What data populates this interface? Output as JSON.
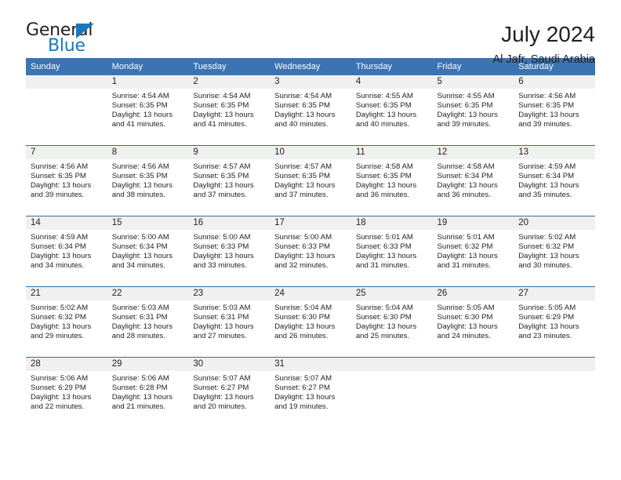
{
  "logo": {
    "primary_text": "General",
    "secondary_text": "Blue",
    "triangle_icon": "triangle-icon",
    "accent_color": "#1878be"
  },
  "header": {
    "title": "July 2024",
    "location": "Al Jafr, Saudi Arabia"
  },
  "theme": {
    "header_blue": "#3b74b4",
    "row_border_blue": "#2e6da4",
    "daynum_band": "#f0f0f0",
    "text": "#231f20"
  },
  "calendar": {
    "weekday_headers": [
      "Sunday",
      "Monday",
      "Tuesday",
      "Wednesday",
      "Thursday",
      "Friday",
      "Saturday"
    ],
    "weeks": [
      [
        {
          "day": "",
          "lines": []
        },
        {
          "day": "1",
          "lines": [
            "Sunrise: 4:54 AM",
            "Sunset: 6:35 PM",
            "Daylight: 13 hours and 41 minutes."
          ]
        },
        {
          "day": "2",
          "lines": [
            "Sunrise: 4:54 AM",
            "Sunset: 6:35 PM",
            "Daylight: 13 hours and 41 minutes."
          ]
        },
        {
          "day": "3",
          "lines": [
            "Sunrise: 4:54 AM",
            "Sunset: 6:35 PM",
            "Daylight: 13 hours and 40 minutes."
          ]
        },
        {
          "day": "4",
          "lines": [
            "Sunrise: 4:55 AM",
            "Sunset: 6:35 PM",
            "Daylight: 13 hours and 40 minutes."
          ]
        },
        {
          "day": "5",
          "lines": [
            "Sunrise: 4:55 AM",
            "Sunset: 6:35 PM",
            "Daylight: 13 hours and 39 minutes."
          ]
        },
        {
          "day": "6",
          "lines": [
            "Sunrise: 4:56 AM",
            "Sunset: 6:35 PM",
            "Daylight: 13 hours and 39 minutes."
          ]
        }
      ],
      [
        {
          "day": "7",
          "lines": [
            "Sunrise: 4:56 AM",
            "Sunset: 6:35 PM",
            "Daylight: 13 hours and 39 minutes."
          ]
        },
        {
          "day": "8",
          "lines": [
            "Sunrise: 4:56 AM",
            "Sunset: 6:35 PM",
            "Daylight: 13 hours and 38 minutes."
          ]
        },
        {
          "day": "9",
          "lines": [
            "Sunrise: 4:57 AM",
            "Sunset: 6:35 PM",
            "Daylight: 13 hours and 37 minutes."
          ]
        },
        {
          "day": "10",
          "lines": [
            "Sunrise: 4:57 AM",
            "Sunset: 6:35 PM",
            "Daylight: 13 hours and 37 minutes."
          ]
        },
        {
          "day": "11",
          "lines": [
            "Sunrise: 4:58 AM",
            "Sunset: 6:35 PM",
            "Daylight: 13 hours and 36 minutes."
          ]
        },
        {
          "day": "12",
          "lines": [
            "Sunrise: 4:58 AM",
            "Sunset: 6:34 PM",
            "Daylight: 13 hours and 36 minutes."
          ]
        },
        {
          "day": "13",
          "lines": [
            "Sunrise: 4:59 AM",
            "Sunset: 6:34 PM",
            "Daylight: 13 hours and 35 minutes."
          ]
        }
      ],
      [
        {
          "day": "14",
          "lines": [
            "Sunrise: 4:59 AM",
            "Sunset: 6:34 PM",
            "Daylight: 13 hours and 34 minutes."
          ]
        },
        {
          "day": "15",
          "lines": [
            "Sunrise: 5:00 AM",
            "Sunset: 6:34 PM",
            "Daylight: 13 hours and 34 minutes."
          ]
        },
        {
          "day": "16",
          "lines": [
            "Sunrise: 5:00 AM",
            "Sunset: 6:33 PM",
            "Daylight: 13 hours and 33 minutes."
          ]
        },
        {
          "day": "17",
          "lines": [
            "Sunrise: 5:00 AM",
            "Sunset: 6:33 PM",
            "Daylight: 13 hours and 32 minutes."
          ]
        },
        {
          "day": "18",
          "lines": [
            "Sunrise: 5:01 AM",
            "Sunset: 6:33 PM",
            "Daylight: 13 hours and 31 minutes."
          ]
        },
        {
          "day": "19",
          "lines": [
            "Sunrise: 5:01 AM",
            "Sunset: 6:32 PM",
            "Daylight: 13 hours and 31 minutes."
          ]
        },
        {
          "day": "20",
          "lines": [
            "Sunrise: 5:02 AM",
            "Sunset: 6:32 PM",
            "Daylight: 13 hours and 30 minutes."
          ]
        }
      ],
      [
        {
          "day": "21",
          "lines": [
            "Sunrise: 5:02 AM",
            "Sunset: 6:32 PM",
            "Daylight: 13 hours and 29 minutes."
          ]
        },
        {
          "day": "22",
          "lines": [
            "Sunrise: 5:03 AM",
            "Sunset: 6:31 PM",
            "Daylight: 13 hours and 28 minutes."
          ]
        },
        {
          "day": "23",
          "lines": [
            "Sunrise: 5:03 AM",
            "Sunset: 6:31 PM",
            "Daylight: 13 hours and 27 minutes."
          ]
        },
        {
          "day": "24",
          "lines": [
            "Sunrise: 5:04 AM",
            "Sunset: 6:30 PM",
            "Daylight: 13 hours and 26 minutes."
          ]
        },
        {
          "day": "25",
          "lines": [
            "Sunrise: 5:04 AM",
            "Sunset: 6:30 PM",
            "Daylight: 13 hours and 25 minutes."
          ]
        },
        {
          "day": "26",
          "lines": [
            "Sunrise: 5:05 AM",
            "Sunset: 6:30 PM",
            "Daylight: 13 hours and 24 minutes."
          ]
        },
        {
          "day": "27",
          "lines": [
            "Sunrise: 5:05 AM",
            "Sunset: 6:29 PM",
            "Daylight: 13 hours and 23 minutes."
          ]
        }
      ],
      [
        {
          "day": "28",
          "lines": [
            "Sunrise: 5:06 AM",
            "Sunset: 6:29 PM",
            "Daylight: 13 hours and 22 minutes."
          ]
        },
        {
          "day": "29",
          "lines": [
            "Sunrise: 5:06 AM",
            "Sunset: 6:28 PM",
            "Daylight: 13 hours and 21 minutes."
          ]
        },
        {
          "day": "30",
          "lines": [
            "Sunrise: 5:07 AM",
            "Sunset: 6:27 PM",
            "Daylight: 13 hours and 20 minutes."
          ]
        },
        {
          "day": "31",
          "lines": [
            "Sunrise: 5:07 AM",
            "Sunset: 6:27 PM",
            "Daylight: 13 hours and 19 minutes."
          ]
        },
        {
          "day": "",
          "lines": []
        },
        {
          "day": "",
          "lines": []
        },
        {
          "day": "",
          "lines": []
        }
      ]
    ]
  }
}
